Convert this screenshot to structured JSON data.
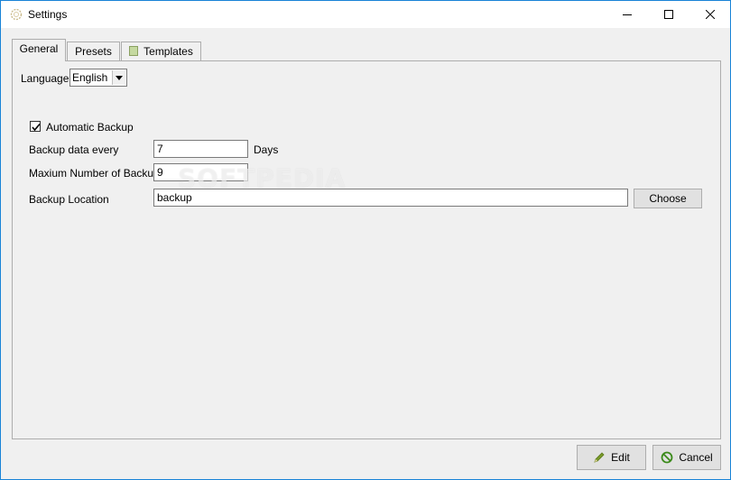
{
  "window": {
    "title": "Settings"
  },
  "tabs": [
    {
      "label": "General",
      "active": true
    },
    {
      "label": "Presets",
      "active": false
    },
    {
      "label": "Templates",
      "active": false
    }
  ],
  "general": {
    "language_label": "Language",
    "language_value": "English",
    "auto_backup_label": "Automatic Backup",
    "auto_backup_checked": true,
    "backup_every_label": "Backup data every",
    "backup_every_value": "7",
    "backup_every_unit": "Days",
    "max_backups_label": "Maxium Number of Backups",
    "max_backups_value": "9",
    "location_label": "Backup Location",
    "location_value": "backup",
    "choose_label": "Choose"
  },
  "footer": {
    "edit_label": "Edit",
    "cancel_label": "Cancel"
  },
  "watermark": "SOFTPEDIA",
  "icons": {
    "app": "gear-icon",
    "templates_tab": "page-icon",
    "edit": "pencil-icon",
    "cancel": "no-entry-icon"
  },
  "colors": {
    "window_border": "#1883d7",
    "panel_bg": "#f0f0f0",
    "button_bg": "#e1e1e1",
    "edit_icon": "#6b8e23",
    "cancel_icon": "#3a8a1a"
  }
}
